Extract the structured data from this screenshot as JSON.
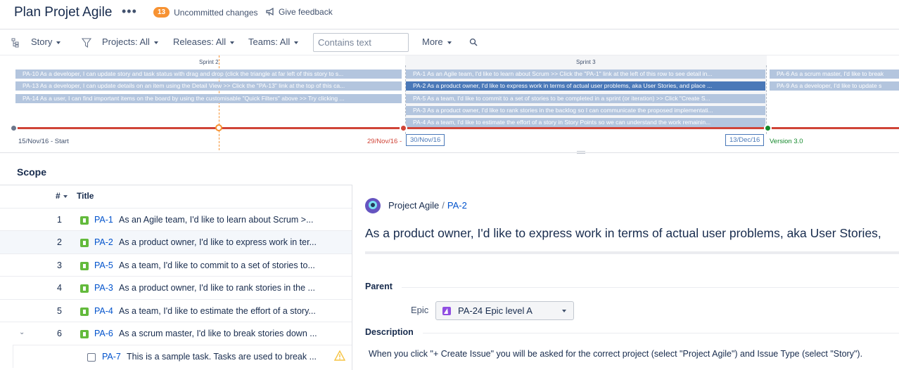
{
  "header": {
    "title": "Plan Projet Agile",
    "more": "•••",
    "uncommitted_count": "13",
    "uncommitted_label": "Uncommitted changes",
    "feedback_label": "Give feedback"
  },
  "toolbar": {
    "story_label": "Story",
    "projects_label": "Projects: All",
    "releases_label": "Releases: All",
    "teams_label": "Teams: All",
    "search_placeholder": "Contains text",
    "more_label": "More"
  },
  "timeline": {
    "sprints": [
      "Sprint 2",
      "Sprint 3"
    ],
    "bars": [
      "PA-10 As a developer, I can update story and task status with drag and drop (click the triangle at far left of this story to s...",
      "PA-13 As a developer, I can update details on an item using the Detail View >> Click the \"PA-13\" link at the top of this ca...",
      "PA-14 As a user, I can find important items on the board by using the customisable \"Quick Filters\" above >> Try clicking ...",
      "PA-1 As an Agile team, I'd like to learn about Scrum >> Click the \"PA-1\" link at the left of this row to see detail in...",
      "PA-2 As a product owner, I'd like to express work in terms of actual user problems, aka User Stories, and place ...",
      "PA-5 As a team, I'd like to commit to a set of stories to be completed in a sprint (or iteration) >> Click \"Create S...",
      "PA-3 As a product owner, I'd like to rank stories in the backlog so I can communicate the proposed implementati...",
      "PA-4 As a team, I'd like to estimate the effort of a story in Story Points so we can understand the work remainin...",
      "PA-6 As a scrum master, I'd like to break",
      "PA-9 As a developer, I'd like to update s"
    ],
    "dates": {
      "start": "15/Nov/16 - Start",
      "mid": "29/Nov/16 -",
      "mid_box": "30/Nov/16",
      "end_box": "13/Dec/16",
      "version": "Version 3.0"
    },
    "colors": {
      "bar": "#b3c5de",
      "selected_bar": "#4a78b8",
      "line": "#d04437",
      "today": "#f79232",
      "version": "#14892c"
    }
  },
  "scope": {
    "title": "Scope",
    "col_num": "#",
    "col_title": "Title",
    "rows": [
      {
        "num": "1",
        "key": "PA-1",
        "summary": "As an Agile team, I'd like to learn about Scrum >..."
      },
      {
        "num": "2",
        "key": "PA-2",
        "summary": "As a product owner, I'd like to express work in ter..."
      },
      {
        "num": "3",
        "key": "PA-5",
        "summary": "As a team, I'd like to commit to a set of stories to..."
      },
      {
        "num": "4",
        "key": "PA-3",
        "summary": "As a product owner, I'd like to rank stories in the ..."
      },
      {
        "num": "5",
        "key": "PA-4",
        "summary": "As a team, I'd like to estimate the effort of a story..."
      },
      {
        "num": "6",
        "key": "PA-6",
        "summary": "As a scrum master, I'd like to break stories down ..."
      },
      {
        "num": "",
        "key": "PA-7",
        "summary": "This is a sample task. Tasks are used to break ..."
      }
    ]
  },
  "detail": {
    "project": "Project Agile",
    "sep": "/",
    "issue_key": "PA-2",
    "title": "As a product owner, I'd like to express work in terms of actual user problems, aka User Stories,",
    "parent_heading": "Parent",
    "epic_label": "Epic",
    "epic_value": "PA-24 Epic level A",
    "description_heading": "Description",
    "description": "When you click \"+ Create Issue\" you will be asked for the correct project (select \"Project Agile\") and Issue Type (select \"Story\")."
  }
}
